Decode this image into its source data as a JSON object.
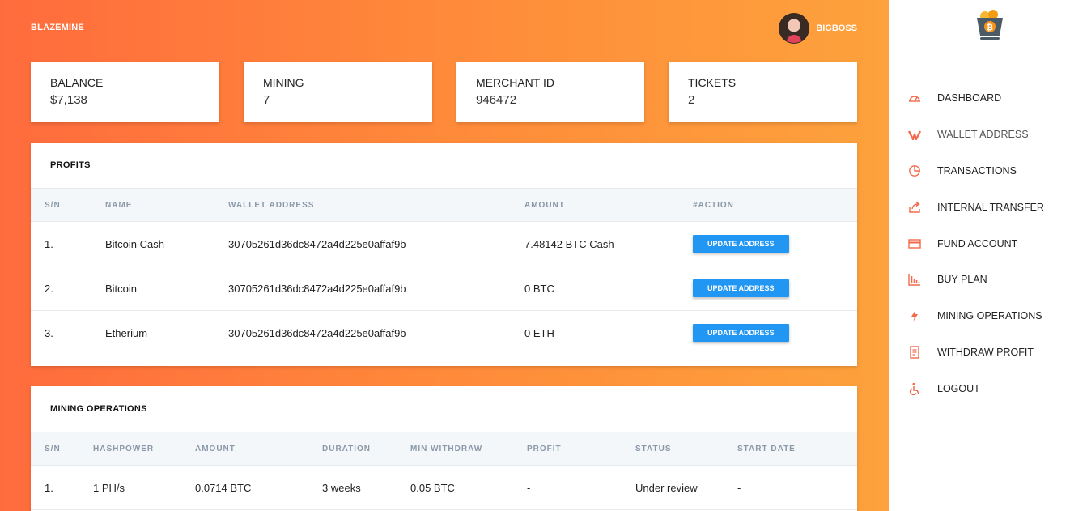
{
  "header": {
    "brand": "BLAZEMINE",
    "username": "BIGBOSS"
  },
  "stats": [
    {
      "label": "BALANCE",
      "value": "$7,138"
    },
    {
      "label": "MINING",
      "value": "7"
    },
    {
      "label": "MERCHANT ID",
      "value": "946472"
    },
    {
      "label": "TICKETS",
      "value": "2"
    }
  ],
  "profits": {
    "title": "PROFITS",
    "columns": [
      "S/N",
      "NAME",
      "WALLET ADDRESS",
      "AMOUNT",
      "#ACTION"
    ],
    "rows": [
      {
        "sn": "1.",
        "name": "Bitcoin Cash",
        "wallet": "30705261d36dc8472a4d225e0affaf9b",
        "amount": "7.48142 BTC Cash",
        "action": "UPDATE ADDRESS"
      },
      {
        "sn": "2.",
        "name": "Bitcoin",
        "wallet": "30705261d36dc8472a4d225e0affaf9b",
        "amount": "0 BTC",
        "action": "UPDATE ADDRESS"
      },
      {
        "sn": "3.",
        "name": "Etherium",
        "wallet": "30705261d36dc8472a4d225e0affaf9b",
        "amount": "0 ETH",
        "action": "UPDATE ADDRESS"
      }
    ]
  },
  "mining": {
    "title": "MINING OPERATIONS",
    "columns": [
      "S/N",
      "HASHPOWER",
      "AMOUNT",
      "DURATION",
      "MIN WITHDRAW",
      "PROFIT",
      "STATUS",
      "START DATE"
    ],
    "rows": [
      {
        "sn": "1.",
        "hashpower": "1 PH/s",
        "amount": "0.0714 BTC",
        "duration": "3 weeks",
        "min_withdraw": "0.05 BTC",
        "profit": "-",
        "status": "Under review",
        "start_date": "-"
      }
    ]
  },
  "sidebar": {
    "items": [
      {
        "label": "DASHBOARD",
        "icon": "dashboard-gauge-icon"
      },
      {
        "label": "WALLET ADDRESS",
        "icon": "wallet-icon"
      },
      {
        "label": "TRANSACTIONS",
        "icon": "pie-chart-icon"
      },
      {
        "label": "INTERNAL TRANSFER",
        "icon": "share-icon"
      },
      {
        "label": "FUND ACCOUNT",
        "icon": "credit-card-icon"
      },
      {
        "label": "BUY PLAN",
        "icon": "bar-chart-icon"
      },
      {
        "label": "MINING OPERATIONS",
        "icon": "lightning-icon"
      },
      {
        "label": "WITHDRAW PROFIT",
        "icon": "receipt-icon"
      },
      {
        "label": "LOGOUT",
        "icon": "accessibility-icon"
      }
    ]
  },
  "colors": {
    "accent": "#f26a4b",
    "button": "#2196f3",
    "gradient_start": "#ff6b3d",
    "gradient_end": "#fda23c"
  }
}
